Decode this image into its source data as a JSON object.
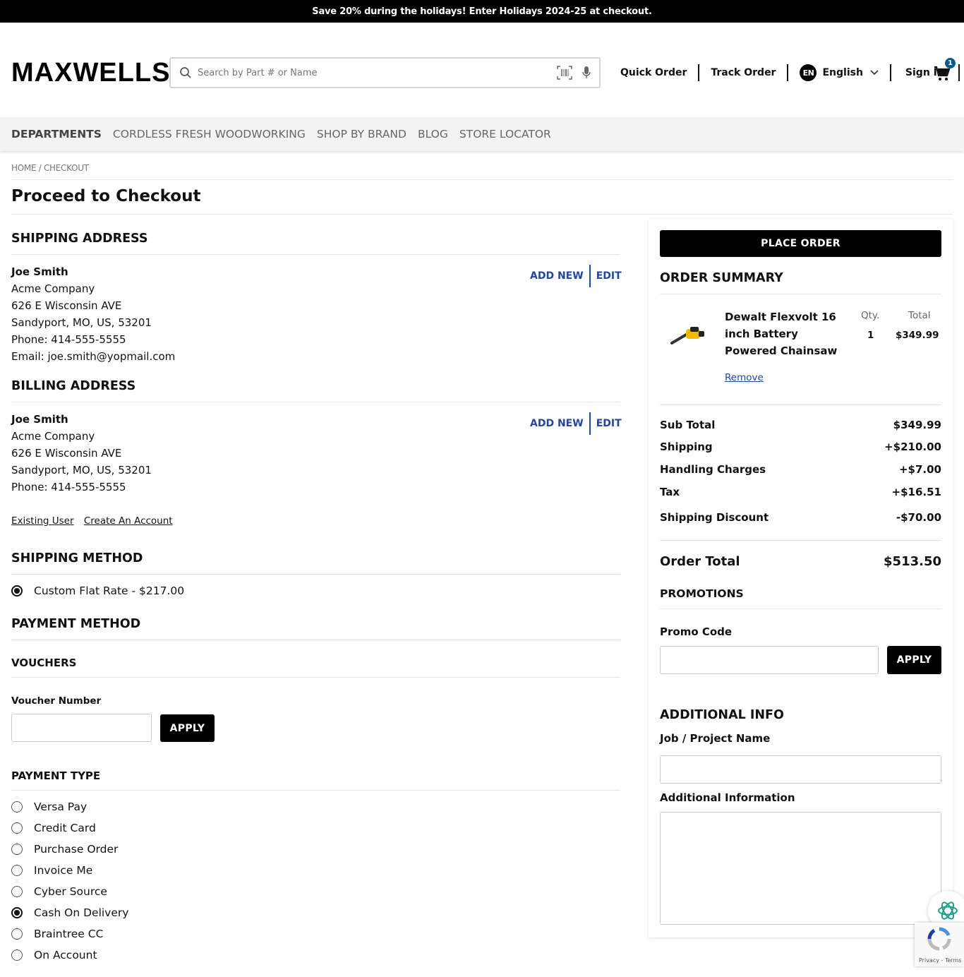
{
  "promo_bar": {
    "text": "Save 20% during the holidays! Enter Holidays 2024-25 at checkout."
  },
  "header": {
    "logo": "MAXWELLS",
    "search_placeholder": "Search by Part # or Name",
    "quick_order": "Quick Order",
    "track_order": "Track Order",
    "language_code": "EN",
    "language": "English",
    "sign_in": "Sign In",
    "cart_count": "1"
  },
  "category_nav": [
    "DEPARTMENTS",
    "CORDLESS FRESH WOODWORKING",
    "SHOP BY BRAND",
    "BLOG",
    "STORE LOCATOR"
  ],
  "breadcrumb": "HOME / CHECKOUT",
  "page_title": "Proceed to Checkout",
  "shipping_address": {
    "title": "SHIPPING ADDRESS",
    "name": "Joe Smith",
    "company": "Acme Company",
    "street": "626 E Wisconsin AVE",
    "city_line": "Sandyport, MO, US, 53201",
    "phone": "Phone: 414-555-5555",
    "email": "Email: joe.smith@yopmail.com",
    "add_new": "ADD NEW",
    "edit": "EDIT"
  },
  "billing_address": {
    "title": "BILLING ADDRESS",
    "name": "Joe Smith",
    "company": "Acme Company",
    "street": "626 E Wisconsin AVE",
    "city_line": "Sandyport, MO, US, 53201",
    "phone": "Phone: 414-555-5555",
    "add_new": "ADD NEW",
    "edit": "EDIT"
  },
  "account_links": {
    "existing_user": "Existing User",
    "create_account": "Create An Account"
  },
  "shipping_method": {
    "title": "SHIPPING METHOD",
    "option": "Custom Flat Rate - $217.00"
  },
  "payment_method": {
    "title": "PAYMENT METHOD",
    "vouchers_title": "VOUCHERS",
    "voucher_label": "Voucher Number",
    "apply": "APPLY",
    "payment_type_title": "PAYMENT TYPE",
    "options": [
      "Versa Pay",
      "Credit Card",
      "Purchase Order",
      "Invoice Me",
      "Cyber Source",
      "Cash On Delivery",
      "Braintree CC",
      "On Account"
    ],
    "selected": "Cash On Delivery"
  },
  "sidebar": {
    "place_order": "PLACE ORDER",
    "order_summary_title": "ORDER SUMMARY",
    "product": {
      "name": "Dewalt Flexvolt 16 inch Battery Powered Chainsaw",
      "qty_label": "Qty.",
      "qty": "1",
      "total_label": "Total",
      "total": "$349.99",
      "remove": "Remove"
    },
    "summary": {
      "subtotal_label": "Sub Total",
      "subtotal": "$349.99",
      "shipping_label": "Shipping",
      "shipping": "+$210.00",
      "handling_label": "Handling Charges",
      "handling": "+$7.00",
      "tax_label": "Tax",
      "tax": "+$16.51",
      "discount_label": "Shipping Discount",
      "discount": "-$70.00"
    },
    "order_total_label": "Order Total",
    "order_total": "$513.50",
    "promotions_title": "PROMOTIONS",
    "promo_code_label": "Promo Code",
    "apply": "APPLY",
    "additional_info_title": "ADDITIONAL INFO",
    "job_label": "Job / Project Name",
    "additional_label": "Additional Information"
  },
  "recaptcha": {
    "terms": "Privacy - Terms"
  },
  "colors": {
    "accent_link": "#2346a0",
    "cart_badge": "#0a5a8a",
    "assistant": "#1aa08a"
  }
}
